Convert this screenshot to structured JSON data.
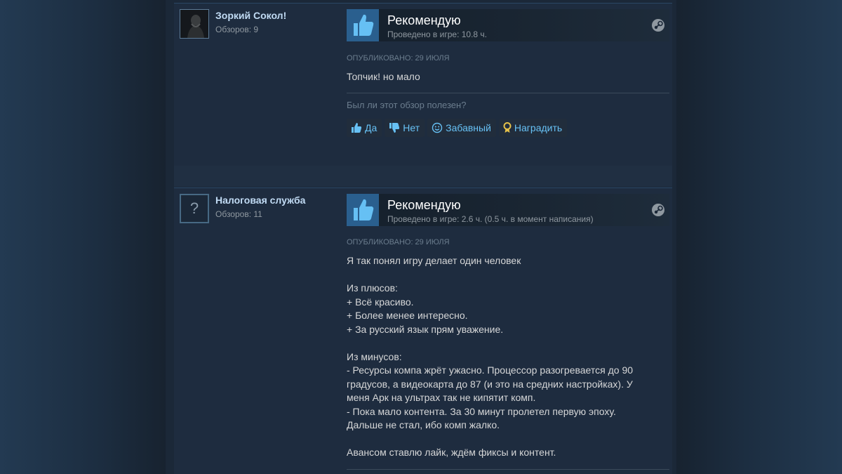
{
  "reviews": [
    {
      "author": {
        "name": "Зоркий Сокол!",
        "reviews_count": "Обзоров: 9",
        "avatar": "dark-character-avatar"
      },
      "vote": {
        "title": "Рекомендую",
        "hours": "Проведено в игре: 10.8 ч.",
        "icon": "thumbs-up-icon",
        "platform_icon": "steam-icon"
      },
      "posted": "ОПУБЛИКОВАНО: 29 ИЮЛЯ",
      "text_lines": [
        "Топчик! но мало"
      ],
      "helpful_question": "Был ли этот обзор полезен?",
      "actions": [
        {
          "label": "Да",
          "icon": "thumbs-up-icon"
        },
        {
          "label": "Нет",
          "icon": "thumbs-down-icon"
        },
        {
          "label": "Забавный",
          "icon": "smiley-icon"
        },
        {
          "label": "Наградить",
          "icon": "award-icon"
        }
      ]
    },
    {
      "author": {
        "name": "Налоговая служба",
        "reviews_count": "Обзоров: 11",
        "avatar": "?"
      },
      "vote": {
        "title": "Рекомендую",
        "hours": "Проведено в игре: 2.6 ч. (0.5 ч. в момент написания)",
        "icon": "thumbs-up-icon",
        "platform_icon": "steam-icon"
      },
      "posted": "ОПУБЛИКОВАНО: 29 ИЮЛЯ",
      "text_lines": [
        "Я так понял игру делает один человек",
        "",
        "Из плюсов:",
        "+ Всё красиво.",
        "+ Более менее интересно.",
        "+ За русский язык прям уважение.",
        "",
        "Из минусов:",
        "- Ресурсы компа жрёт ужасно. Процессор разогревается до 90",
        "градусов, а видеокарта до 87 (и это на средних настройках). У",
        "меня Арк на ультрах так не кипятит комп.",
        "- Пока мало контента. За 30 минут пролетел первую эпоху.",
        "Дальше не стал, ибо комп жалко.",
        "",
        "Авансом ставлю лайк, ждём фиксы и контент."
      ]
    }
  ],
  "colors": {
    "accent": "#67c1f5",
    "author": "#c1dbf4",
    "thumb_bg": "#2a5f8e",
    "award": "#e5c14a"
  }
}
